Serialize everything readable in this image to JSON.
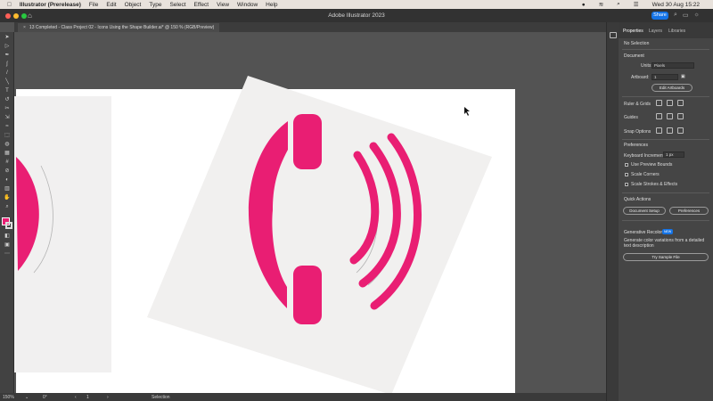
{
  "menubar": {
    "apple": "",
    "app": "Illustrator (Prerelease)",
    "items": [
      "File",
      "Edit",
      "Object",
      "Type",
      "Select",
      "Effect",
      "View",
      "Window",
      "Help"
    ],
    "datetime": "Wed 30 Aug  15:22"
  },
  "window": {
    "title": "Adobe Illustrator 2023",
    "share_label": "Share"
  },
  "document_tab": {
    "close": "×",
    "label": "13 Completed - Class Project 02 - Icons Using the Shape Builder.ai* @ 150 % (RGB/Preview)"
  },
  "status": {
    "zoom": "150%",
    "rotation": "0°",
    "artboard": "1",
    "tool": "Selection"
  },
  "panel": {
    "tabs": [
      "Properties",
      "Layers",
      "Libraries"
    ],
    "no_selection": "No Selection",
    "document_heading": "Document",
    "units_label": "Units:",
    "units_value": "Pixels",
    "artboard_label": "Artboard:",
    "artboard_value": "1",
    "edit_artboards": "Edit Artboards",
    "ruler_grids": "Ruler & Grids",
    "guides": "Guides",
    "snap_options": "Snap Options",
    "preferences_heading": "Preferences",
    "keyboard_increment_label": "Keyboard Increment:",
    "keyboard_increment_value": "1 px",
    "use_preview_bounds": "Use Preview Bounds",
    "scale_corners": "Scale Corners",
    "scale_strokes": "Scale Strokes & Effects",
    "quick_actions": "Quick Actions",
    "document_setup": "Document Setup",
    "preferences_button": "Preferences",
    "generative_recolor": "Generative Recolor",
    "new_badge": "NEW",
    "gen_desc_1": "Generate color variations from a detailed",
    "gen_desc_2": "text description",
    "try_sample": "Try Sample File"
  },
  "colors": {
    "accent": "#e91e73",
    "ui_blue": "#1473e6"
  }
}
